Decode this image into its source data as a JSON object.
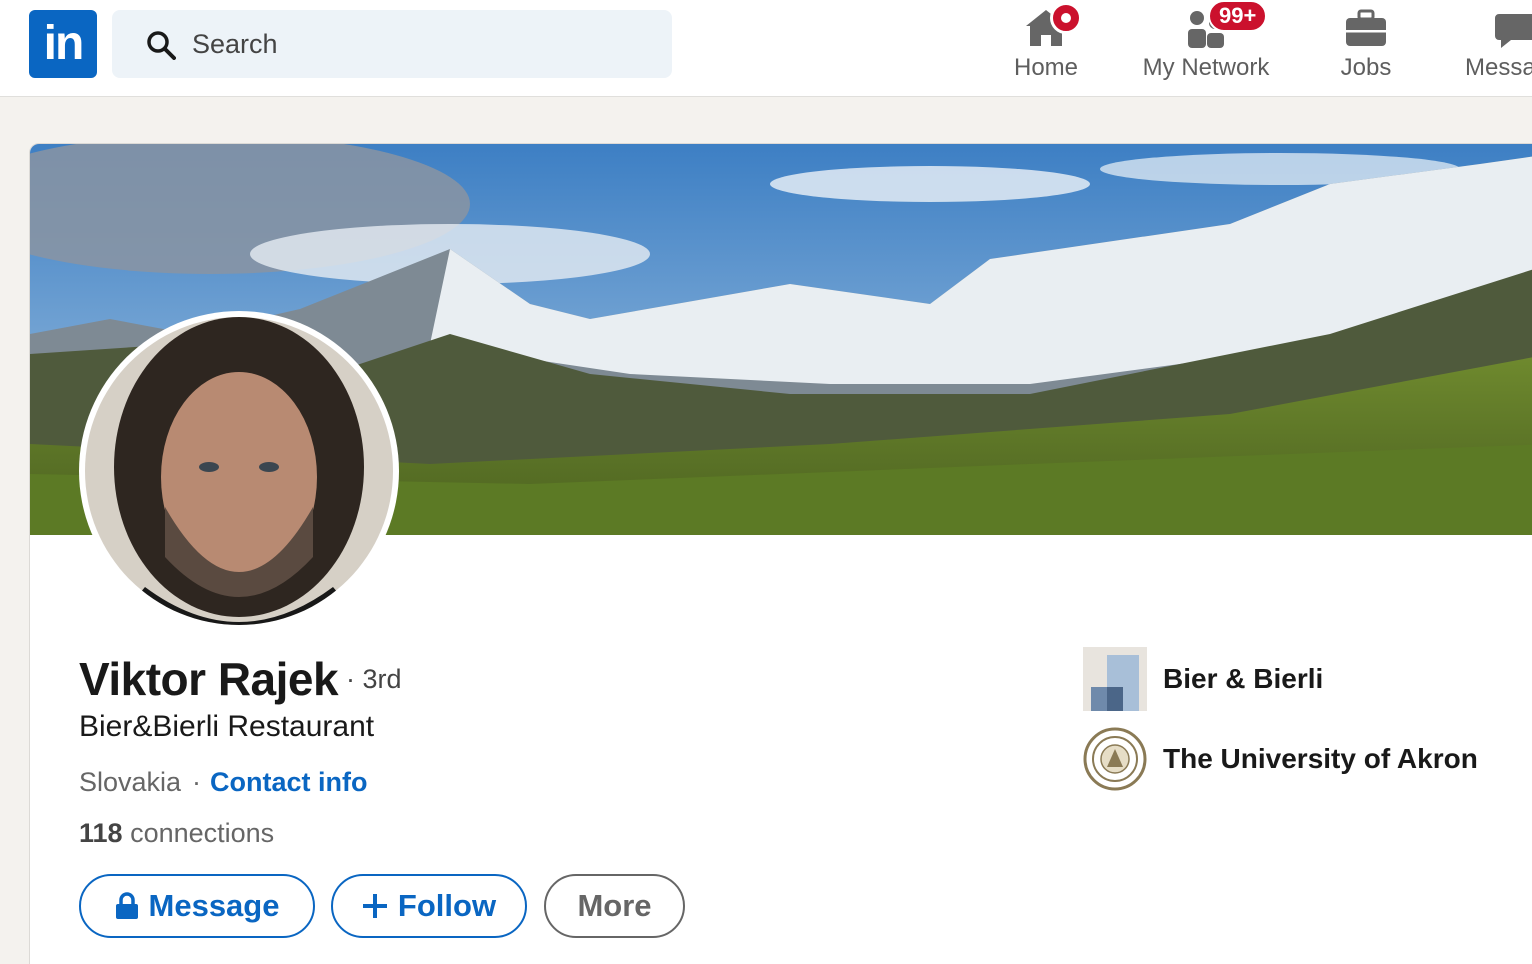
{
  "nav": {
    "logo_text": "in",
    "search_placeholder": "Search",
    "items": [
      {
        "label": "Home",
        "icon": "home-icon"
      },
      {
        "label": "My Network",
        "icon": "people-icon",
        "badge": "99+"
      },
      {
        "label": "Jobs",
        "icon": "briefcase-icon"
      },
      {
        "label": "Messa",
        "icon": "chat-icon"
      }
    ]
  },
  "profile": {
    "name": "Viktor Rajek",
    "degree": "· 3rd",
    "headline": "Bier&Bierli Restaurant",
    "location": "Slovakia",
    "separator": "·",
    "contact_link": "Contact info",
    "connections_count": "118",
    "connections_label": "connections",
    "actions": {
      "message": "Message",
      "follow": "Follow",
      "more": "More"
    },
    "organizations": [
      {
        "name": "Bier & Bierli",
        "icon": "company-logo"
      },
      {
        "name": "The University of Akron",
        "icon": "university-seal"
      }
    ]
  },
  "colors": {
    "brand_blue": "#0a66c2",
    "badge_red": "#cb112d",
    "page_bg": "#f4f2ee"
  }
}
